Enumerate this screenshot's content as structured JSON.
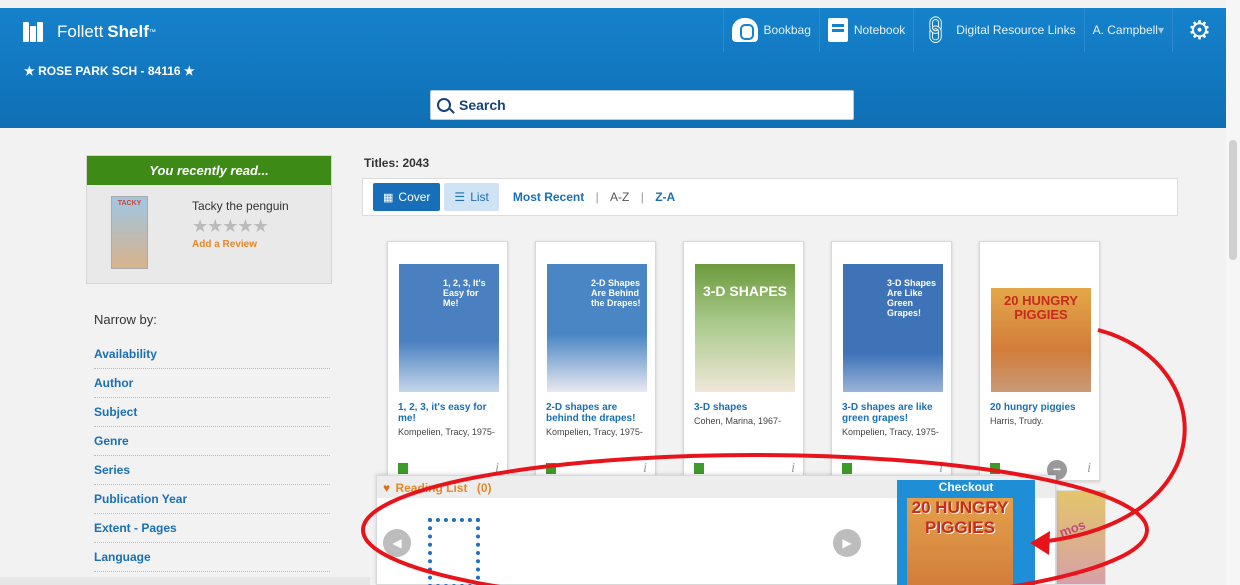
{
  "header": {
    "brand_name": "Follett",
    "brand_product": "Shelf",
    "brand_tm": "™",
    "school": "★ ROSE PARK SCH - 84116 ★",
    "nav": {
      "bookbag": "Bookbag",
      "notebook": "Notebook",
      "digital": "Digital Resource Links",
      "user": "A. Campbell"
    },
    "search_label": "Search"
  },
  "recent": {
    "heading": "You recently read...",
    "cover_text": "TACKY",
    "title": "Tacky the penguin",
    "stars": "★★★★★",
    "review_link": "Add a Review"
  },
  "narrow": {
    "title": "Narrow by:",
    "facets": [
      "Availability",
      "Author",
      "Subject",
      "Genre",
      "Series",
      "Publication Year",
      "Extent - Pages",
      "Language"
    ]
  },
  "results": {
    "titles_count": "Titles: 2043",
    "view_cover": "Cover",
    "view_list": "List",
    "sort_recent": "Most Recent",
    "sort_az": "A-Z",
    "sort_za": "Z-A",
    "sep": "|"
  },
  "books": [
    {
      "cover_text": "1, 2, 3, It's Easy for Me!",
      "title": "1, 2, 3, it's easy for me!",
      "author": "Kompelien, Tracy, 1975-",
      "cover_color": "#4a7fc0"
    },
    {
      "cover_text": "2-D Shapes Are Behind the Drapes!",
      "title": "2-D shapes are behind the drapes!",
      "author": "Kompelien, Tracy, 1975-",
      "cover_color": "#4a86c4"
    },
    {
      "cover_text": "3-D SHAPES",
      "title": "3-D shapes",
      "author": "Cohen, Marina, 1967-",
      "cover_color": "#6c9a3c"
    },
    {
      "cover_text": "3-D Shapes Are Like Green Grapes!",
      "title": "3-D shapes are like green grapes!",
      "author": "Kompelien, Tracy, 1975-",
      "cover_color": "#3f73b8"
    },
    {
      "cover_text": "20 HUNGRY PIGGIES",
      "title": "20 hungry piggies",
      "author": "Harris, Trudy.",
      "cover_color": "#d88a3c"
    }
  ],
  "reading_list": {
    "label": "Reading List",
    "count": "(0)",
    "checkout": "Checkout",
    "checkout_cover": "20 HUNGRY PIGGIES"
  },
  "peek_text": "mos",
  "colors": {
    "header_blue": "#1582cc",
    "recent_green": "#3e8a16",
    "link_blue": "#1a6fb5",
    "accent_orange": "#e7882a",
    "annotation_red": "#e8141b"
  }
}
